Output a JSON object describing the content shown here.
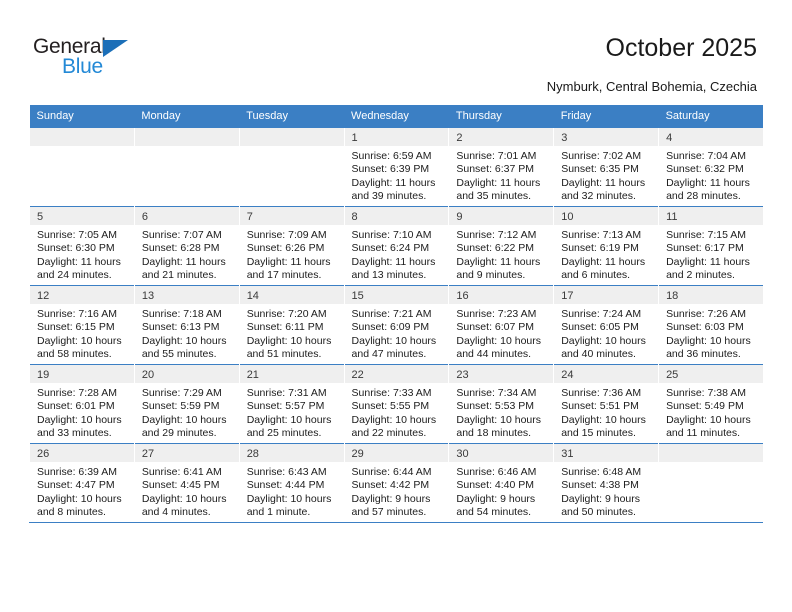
{
  "brand": {
    "name_top": "General",
    "name_bottom": "Blue",
    "color_dark": "#231f20",
    "color_blue": "#2389d6",
    "triangle_color": "#1c6fb8"
  },
  "header": {
    "title": "October 2025",
    "subtitle": "Nymburk, Central Bohemia, Czechia"
  },
  "theme": {
    "header_bar": "#3b7fc4",
    "daynum_band": "#efefef",
    "grid_line": "#3b7fc4",
    "text": "#1c1c1c"
  },
  "weekdays": [
    "Sunday",
    "Monday",
    "Tuesday",
    "Wednesday",
    "Thursday",
    "Friday",
    "Saturday"
  ],
  "labels": {
    "sunrise_prefix": "Sunrise:",
    "sunset_prefix": "Sunset:",
    "daylight_prefix": "Daylight:"
  },
  "weeks": [
    [
      {
        "empty": true
      },
      {
        "empty": true
      },
      {
        "empty": true
      },
      {
        "day": "1",
        "sunrise": "Sunrise: 6:59 AM",
        "sunset": "Sunset: 6:39 PM",
        "daylight": "Daylight: 11 hours and 39 minutes."
      },
      {
        "day": "2",
        "sunrise": "Sunrise: 7:01 AM",
        "sunset": "Sunset: 6:37 PM",
        "daylight": "Daylight: 11 hours and 35 minutes."
      },
      {
        "day": "3",
        "sunrise": "Sunrise: 7:02 AM",
        "sunset": "Sunset: 6:35 PM",
        "daylight": "Daylight: 11 hours and 32 minutes."
      },
      {
        "day": "4",
        "sunrise": "Sunrise: 7:04 AM",
        "sunset": "Sunset: 6:32 PM",
        "daylight": "Daylight: 11 hours and 28 minutes."
      }
    ],
    [
      {
        "day": "5",
        "sunrise": "Sunrise: 7:05 AM",
        "sunset": "Sunset: 6:30 PM",
        "daylight": "Daylight: 11 hours and 24 minutes."
      },
      {
        "day": "6",
        "sunrise": "Sunrise: 7:07 AM",
        "sunset": "Sunset: 6:28 PM",
        "daylight": "Daylight: 11 hours and 21 minutes."
      },
      {
        "day": "7",
        "sunrise": "Sunrise: 7:09 AM",
        "sunset": "Sunset: 6:26 PM",
        "daylight": "Daylight: 11 hours and 17 minutes."
      },
      {
        "day": "8",
        "sunrise": "Sunrise: 7:10 AM",
        "sunset": "Sunset: 6:24 PM",
        "daylight": "Daylight: 11 hours and 13 minutes."
      },
      {
        "day": "9",
        "sunrise": "Sunrise: 7:12 AM",
        "sunset": "Sunset: 6:22 PM",
        "daylight": "Daylight: 11 hours and 9 minutes."
      },
      {
        "day": "10",
        "sunrise": "Sunrise: 7:13 AM",
        "sunset": "Sunset: 6:19 PM",
        "daylight": "Daylight: 11 hours and 6 minutes."
      },
      {
        "day": "11",
        "sunrise": "Sunrise: 7:15 AM",
        "sunset": "Sunset: 6:17 PM",
        "daylight": "Daylight: 11 hours and 2 minutes."
      }
    ],
    [
      {
        "day": "12",
        "sunrise": "Sunrise: 7:16 AM",
        "sunset": "Sunset: 6:15 PM",
        "daylight": "Daylight: 10 hours and 58 minutes."
      },
      {
        "day": "13",
        "sunrise": "Sunrise: 7:18 AM",
        "sunset": "Sunset: 6:13 PM",
        "daylight": "Daylight: 10 hours and 55 minutes."
      },
      {
        "day": "14",
        "sunrise": "Sunrise: 7:20 AM",
        "sunset": "Sunset: 6:11 PM",
        "daylight": "Daylight: 10 hours and 51 minutes."
      },
      {
        "day": "15",
        "sunrise": "Sunrise: 7:21 AM",
        "sunset": "Sunset: 6:09 PM",
        "daylight": "Daylight: 10 hours and 47 minutes."
      },
      {
        "day": "16",
        "sunrise": "Sunrise: 7:23 AM",
        "sunset": "Sunset: 6:07 PM",
        "daylight": "Daylight: 10 hours and 44 minutes."
      },
      {
        "day": "17",
        "sunrise": "Sunrise: 7:24 AM",
        "sunset": "Sunset: 6:05 PM",
        "daylight": "Daylight: 10 hours and 40 minutes."
      },
      {
        "day": "18",
        "sunrise": "Sunrise: 7:26 AM",
        "sunset": "Sunset: 6:03 PM",
        "daylight": "Daylight: 10 hours and 36 minutes."
      }
    ],
    [
      {
        "day": "19",
        "sunrise": "Sunrise: 7:28 AM",
        "sunset": "Sunset: 6:01 PM",
        "daylight": "Daylight: 10 hours and 33 minutes."
      },
      {
        "day": "20",
        "sunrise": "Sunrise: 7:29 AM",
        "sunset": "Sunset: 5:59 PM",
        "daylight": "Daylight: 10 hours and 29 minutes."
      },
      {
        "day": "21",
        "sunrise": "Sunrise: 7:31 AM",
        "sunset": "Sunset: 5:57 PM",
        "daylight": "Daylight: 10 hours and 25 minutes."
      },
      {
        "day": "22",
        "sunrise": "Sunrise: 7:33 AM",
        "sunset": "Sunset: 5:55 PM",
        "daylight": "Daylight: 10 hours and 22 minutes."
      },
      {
        "day": "23",
        "sunrise": "Sunrise: 7:34 AM",
        "sunset": "Sunset: 5:53 PM",
        "daylight": "Daylight: 10 hours and 18 minutes."
      },
      {
        "day": "24",
        "sunrise": "Sunrise: 7:36 AM",
        "sunset": "Sunset: 5:51 PM",
        "daylight": "Daylight: 10 hours and 15 minutes."
      },
      {
        "day": "25",
        "sunrise": "Sunrise: 7:38 AM",
        "sunset": "Sunset: 5:49 PM",
        "daylight": "Daylight: 10 hours and 11 minutes."
      }
    ],
    [
      {
        "day": "26",
        "sunrise": "Sunrise: 6:39 AM",
        "sunset": "Sunset: 4:47 PM",
        "daylight": "Daylight: 10 hours and 8 minutes."
      },
      {
        "day": "27",
        "sunrise": "Sunrise: 6:41 AM",
        "sunset": "Sunset: 4:45 PM",
        "daylight": "Daylight: 10 hours and 4 minutes."
      },
      {
        "day": "28",
        "sunrise": "Sunrise: 6:43 AM",
        "sunset": "Sunset: 4:44 PM",
        "daylight": "Daylight: 10 hours and 1 minute."
      },
      {
        "day": "29",
        "sunrise": "Sunrise: 6:44 AM",
        "sunset": "Sunset: 4:42 PM",
        "daylight": "Daylight: 9 hours and 57 minutes."
      },
      {
        "day": "30",
        "sunrise": "Sunrise: 6:46 AM",
        "sunset": "Sunset: 4:40 PM",
        "daylight": "Daylight: 9 hours and 54 minutes."
      },
      {
        "day": "31",
        "sunrise": "Sunrise: 6:48 AM",
        "sunset": "Sunset: 4:38 PM",
        "daylight": "Daylight: 9 hours and 50 minutes."
      },
      {
        "empty": true
      }
    ]
  ]
}
